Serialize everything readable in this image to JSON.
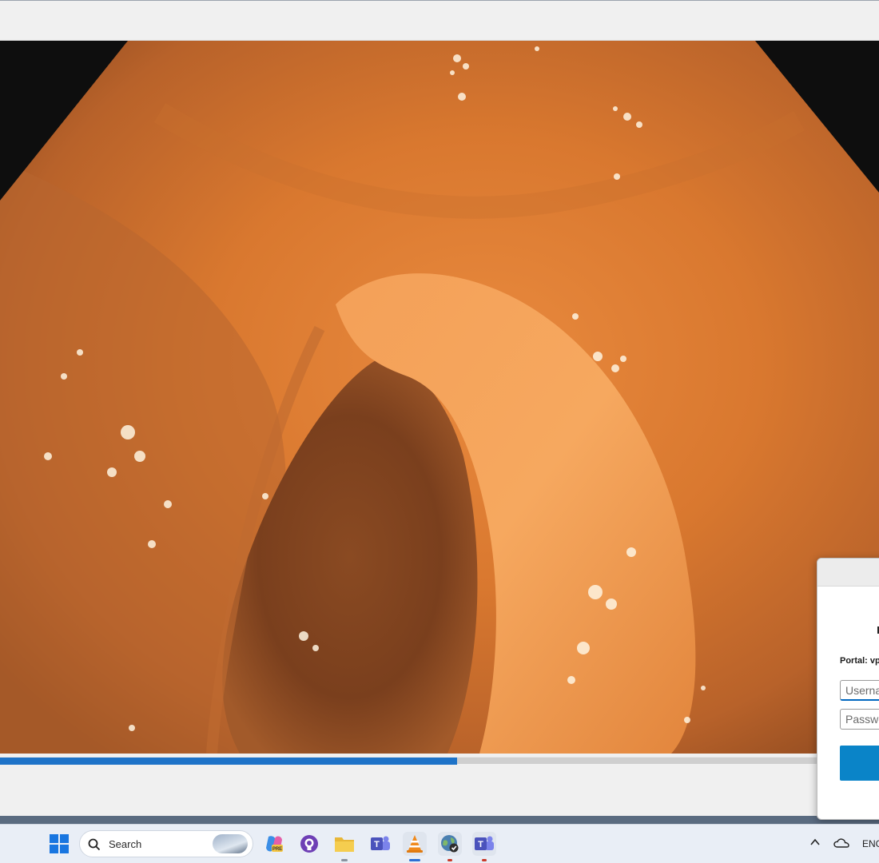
{
  "video": {
    "progress_percent": 52
  },
  "dialog": {
    "portal_label": "Portal: vp",
    "username_placeholder": "Userna",
    "password_placeholder": "Passwo",
    "connect_label": ""
  },
  "taskbar": {
    "search_placeholder": "Search",
    "icons": [
      "windows-start-icon",
      "copilot-icon",
      "github-icon",
      "file-explorer-icon",
      "teams-icon",
      "vlc-icon",
      "vpn-globe-icon",
      "teams-icon"
    ],
    "tray": {
      "language": "ENG"
    }
  },
  "colors": {
    "accent": "#1e73c8",
    "taskbar": "#e9eef6",
    "connect_button": "#0a84c8"
  }
}
